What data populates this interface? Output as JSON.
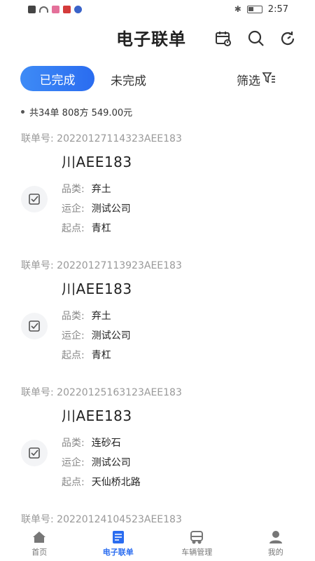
{
  "status_bar": {
    "time": "2:57"
  },
  "header": {
    "title": "电子联单"
  },
  "tabs": {
    "done": "已完成",
    "undone": "未完成"
  },
  "filter": {
    "label": "筛选"
  },
  "summary": {
    "text": "共34单 808方 549.00元"
  },
  "orders": [
    {
      "no_label": "联单号:",
      "no": "20220127114323AEE183",
      "plate": "川AEE183",
      "category_label": "品类:",
      "category": "弃土",
      "company_label": "运企:",
      "company": "测试公司",
      "origin_label": "起点:",
      "origin": "青杠"
    },
    {
      "no_label": "联单号:",
      "no": "20220127113923AEE183",
      "plate": "川AEE183",
      "category_label": "品类:",
      "category": "弃土",
      "company_label": "运企:",
      "company": "测试公司",
      "origin_label": "起点:",
      "origin": "青杠"
    },
    {
      "no_label": "联单号:",
      "no": "20220125163123AEE183",
      "plate": "川AEE183",
      "category_label": "品类:",
      "category": "连砂石",
      "company_label": "运企:",
      "company": "测试公司",
      "origin_label": "起点:",
      "origin": "天仙桥北路"
    },
    {
      "no_label": "联单号:",
      "no": "20220124104523AEE183"
    }
  ],
  "nav": [
    {
      "label": "首页",
      "icon": "home-icon"
    },
    {
      "label": "电子联单",
      "icon": "document-icon"
    },
    {
      "label": "车辆管理",
      "icon": "truck-icon"
    },
    {
      "label": "我的",
      "icon": "user-icon"
    }
  ],
  "colors": {
    "accent": "#2a6cf0",
    "muted": "#999999"
  }
}
